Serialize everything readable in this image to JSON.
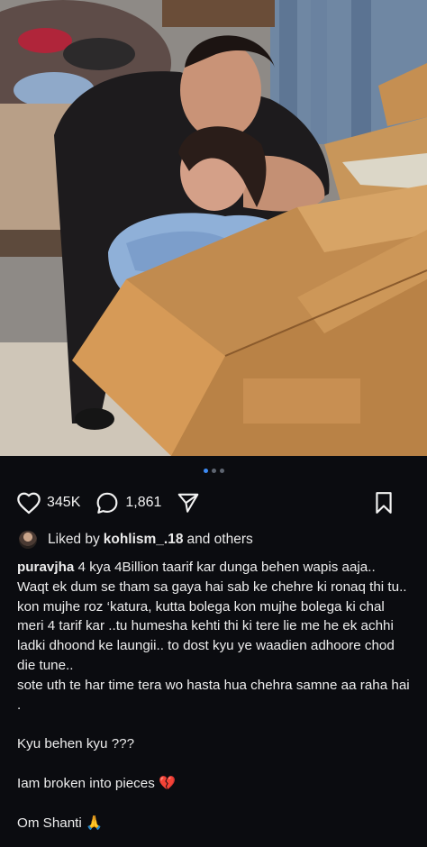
{
  "post": {
    "image_alt": "Two people hugging, one sitting inside a cardboard box",
    "carousel": {
      "count": 3,
      "active_index": 0
    },
    "stats": {
      "likes": "345K",
      "comments": "1,861"
    },
    "icons": {
      "like": "heart-icon",
      "comment": "comment-bubble-icon",
      "share": "send-icon",
      "save": "bookmark-icon"
    },
    "liked_by": {
      "prefix": "Liked by",
      "user": "kohlism_.18",
      "suffix": "and others"
    },
    "caption": {
      "username": "puravjha",
      "line1": "4 kya 4Billion taarif kar dunga behen wapis aaja..",
      "line2": "Waqt ek dum se tham sa gaya hai sab ke chehre ki ronaq thi tu.. kon mujhe roz ‘katura, kutta bolega kon mujhe bolega ki chal meri 4 tarif kar ..tu humesha kehti thi ki tere lie me he ek achhi ladki dhoond ke laungii.. to dost kyu ye waadien adhoore chod die tune..",
      "line3": "sote uth te har time tera wo hasta hua chehra samne aa raha hai .",
      "line4": "Kyu behen kyu ???",
      "line5": "Iam broken into pieces 💔",
      "line6": "Om Shanti 🙏"
    }
  },
  "colors": {
    "background": "#0b0c10",
    "text": "#f2f2f2",
    "carousel_active": "#3d8bf5",
    "carousel_inactive": "#5d6470"
  }
}
